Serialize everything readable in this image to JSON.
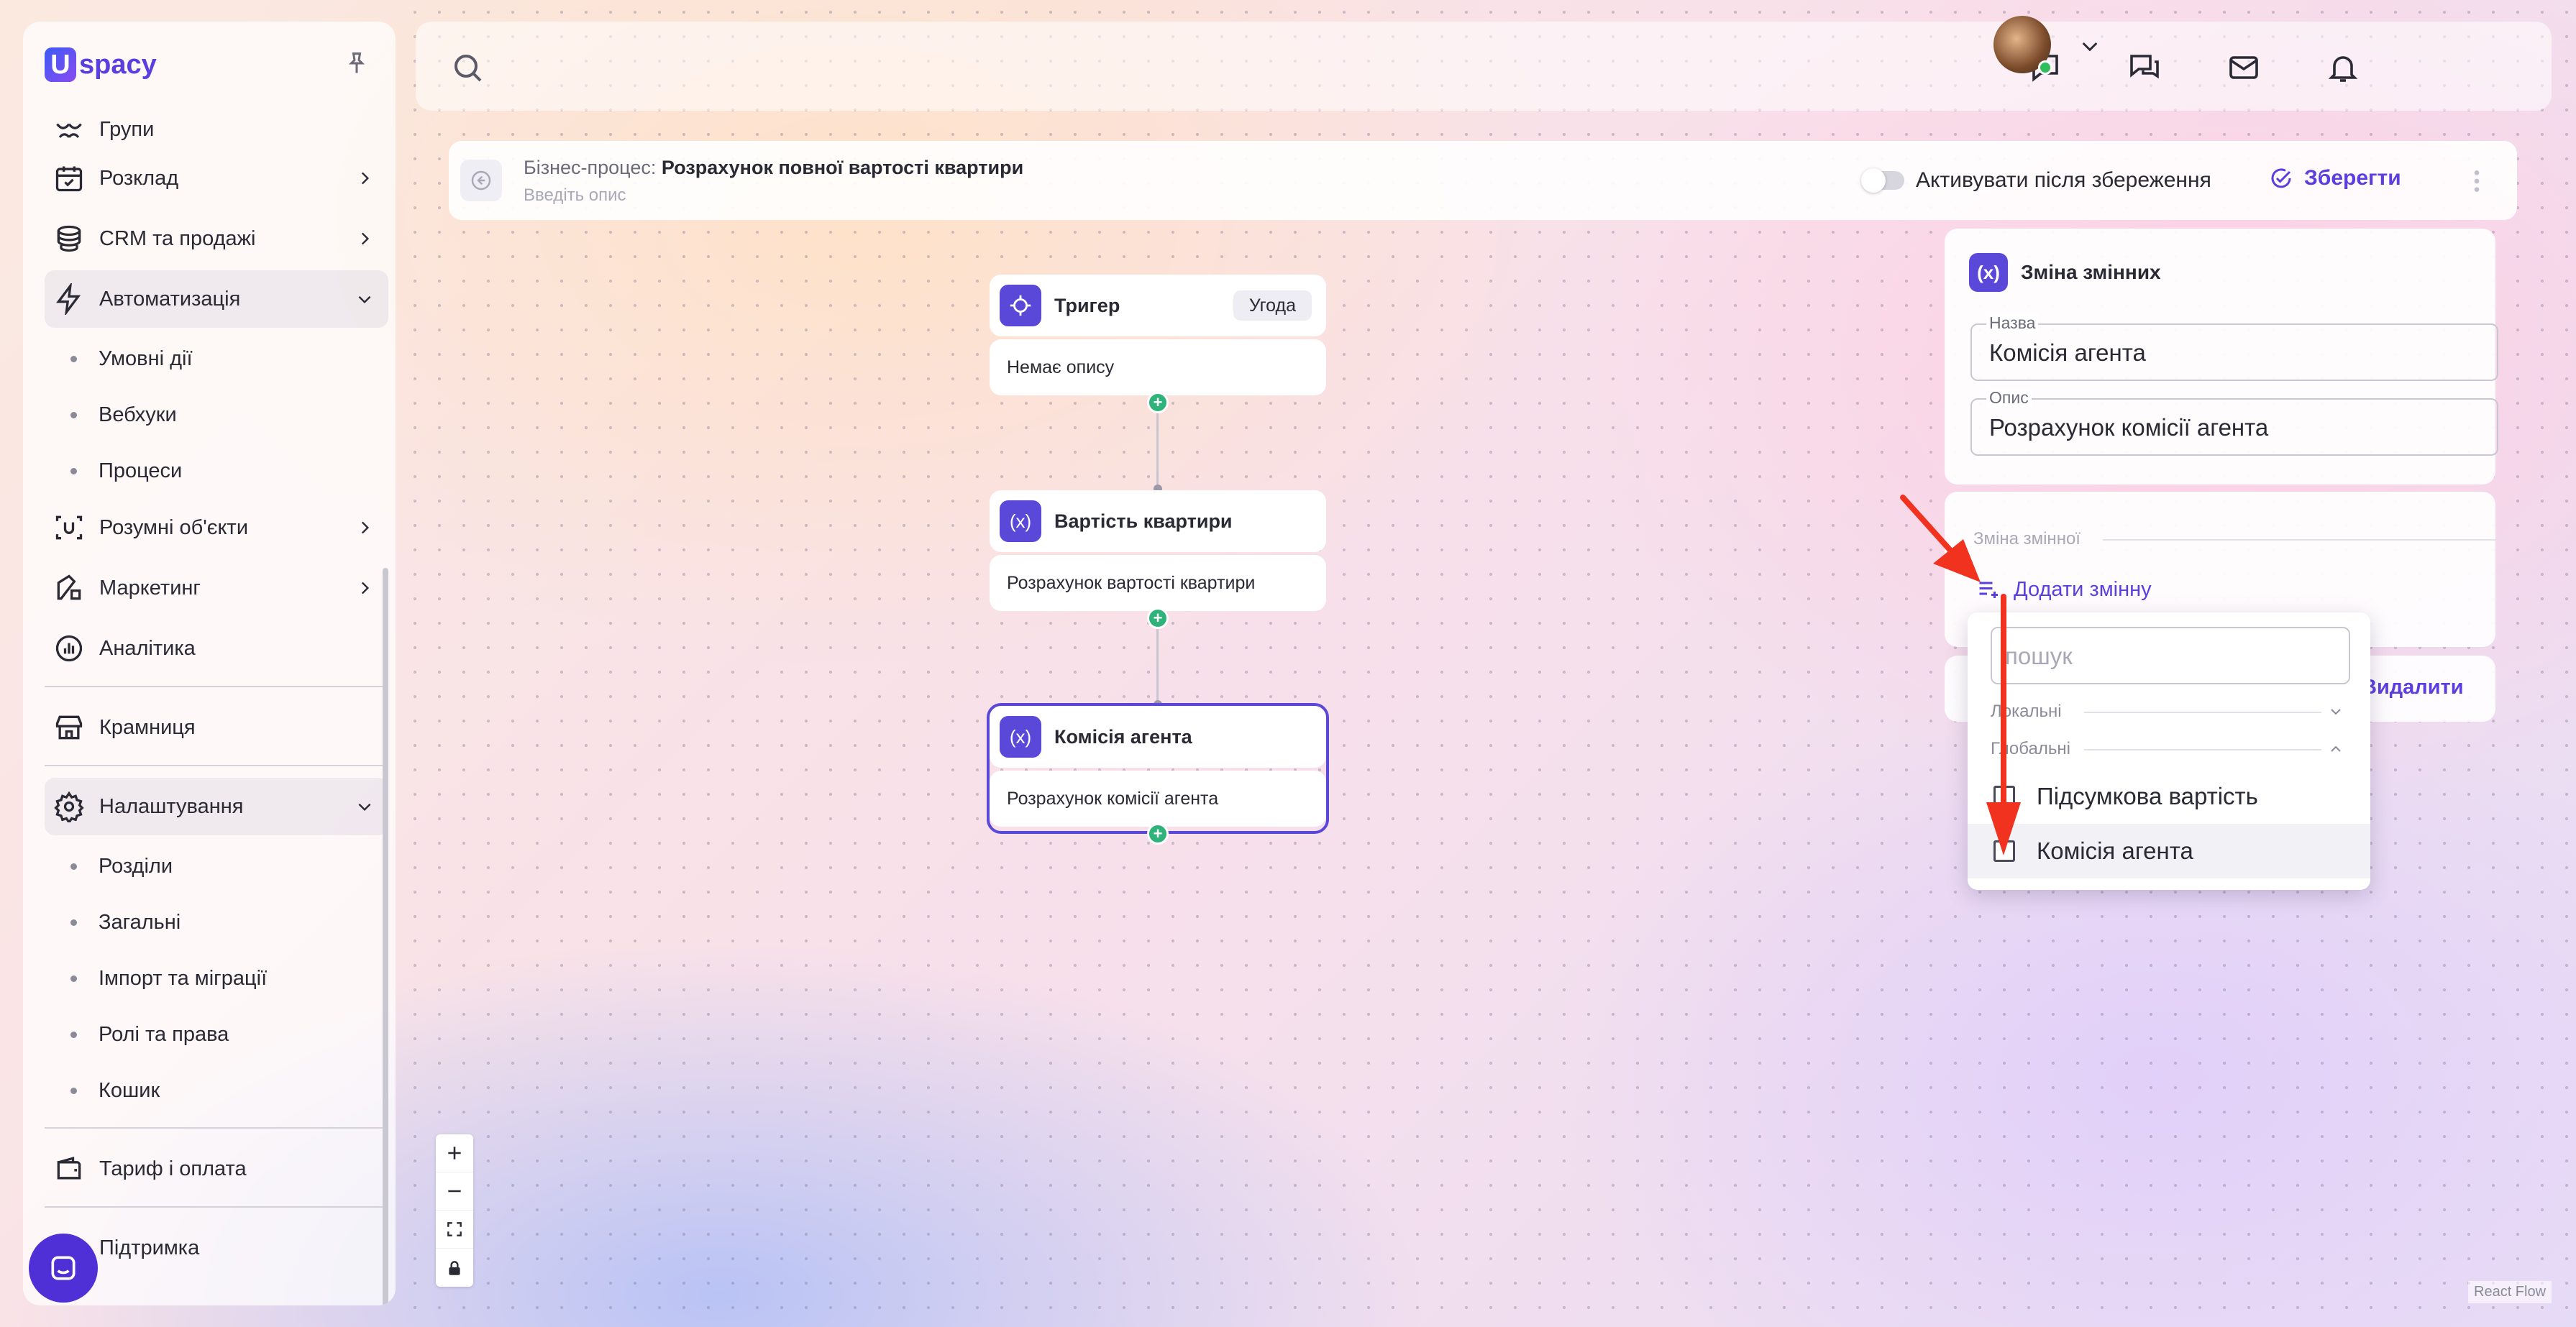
{
  "sidebar": {
    "logo_u": "U",
    "logo_text": "spacy",
    "items": [
      {
        "label": "Групи",
        "icon": "groups-icon"
      },
      {
        "label": "Розклад",
        "icon": "calendar-icon"
      },
      {
        "label": "CRM та продажі",
        "icon": "crm-icon"
      },
      {
        "label": "Автоматизація",
        "icon": "lightning-icon"
      },
      {
        "label": "Розумні об'єкти",
        "icon": "smart-objects-icon"
      },
      {
        "label": "Маркетинг",
        "icon": "marketing-icon"
      },
      {
        "label": "Аналітика",
        "icon": "analytics-icon"
      },
      {
        "label": "Крамниця",
        "icon": "store-icon"
      },
      {
        "label": "Налаштування",
        "icon": "gear-icon"
      },
      {
        "label": "Тариф і оплата",
        "icon": "wallet-icon"
      },
      {
        "label": "Підтримка",
        "icon": "support-icon"
      }
    ],
    "automation_sub": [
      "Умовні дії",
      "Вебхуки",
      "Процеси"
    ],
    "settings_sub": [
      "Розділи",
      "Загальні",
      "Імпорт та міграції",
      "Ролі та права",
      "Кошик"
    ]
  },
  "process": {
    "title_prefix": "Бізнес-процес:",
    "title": "Розрахунок повної вартості квартири",
    "description_placeholder": "Введіть опис",
    "activate_label": "Активувати після збереження",
    "save_label": "Зберегти"
  },
  "nodes": [
    {
      "title": "Тригер",
      "badge": "Угода",
      "body": "Немає опису"
    },
    {
      "title": "Вартість квартири",
      "body": "Розрахунок вартості квартири"
    },
    {
      "title": "Комісія агента",
      "body": "Розрахунок комісії агента"
    }
  ],
  "panel": {
    "title": "Зміна змінних",
    "name_label": "Назва",
    "name_value": "Комісія агента",
    "desc_label": "Опис",
    "desc_value": "Розрахунок комісії агента",
    "section_label": "Зміна змінної",
    "add_variable": "Додати змінну",
    "delete": "Видалити"
  },
  "dropdown": {
    "search_placeholder": "пошук",
    "group_local": "Локальні",
    "group_global": "Глобальні",
    "items": [
      "Підсумкова вартість",
      "Комісія агента"
    ]
  },
  "footer": {
    "react_flow": "React Flow"
  },
  "colors": {
    "accent": "#5a3fe0",
    "node_icon": "#5a48d8",
    "handle": "#2fb37a",
    "arrow": "#f0321e"
  }
}
